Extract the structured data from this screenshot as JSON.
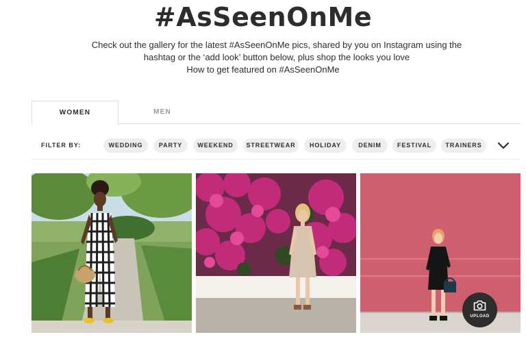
{
  "header": {
    "title": "#AsSeenOnMe",
    "subtitle_line1": "Check out the gallery for the latest #AsSeenOnMe pics, shared by you on Instagram using the",
    "subtitle_line2": "hashtag or the ‘add look’ button below, plus shop the looks you love",
    "howto_link": "How to get featured on #AsSeenOnMe"
  },
  "tabs": [
    {
      "label": "WOMEN",
      "active": true
    },
    {
      "label": "MEN",
      "active": false
    }
  ],
  "filter": {
    "label": "FILTER BY:",
    "options": [
      "WEDDING",
      "PARTY",
      "WEEKEND",
      "STREETWEAR",
      "HOLIDAY",
      "DENIM",
      "FESTIVAL",
      "TRAINERS"
    ],
    "expand_icon": "chevron-down-icon"
  },
  "gallery": {
    "photos": [
      {
        "subject": "gingham-jumpsuit-look"
      },
      {
        "subject": "slip-dress-bougainvillea-look"
      },
      {
        "subject": "black-dress-pink-wall-look"
      }
    ]
  },
  "upload": {
    "label": "UPLOAD",
    "icon": "camera-icon"
  },
  "colors": {
    "text": "#2d2d2d",
    "pill_bg": "#eeeeee",
    "muted": "#999999",
    "upload_bg": "#2d2d2d"
  }
}
